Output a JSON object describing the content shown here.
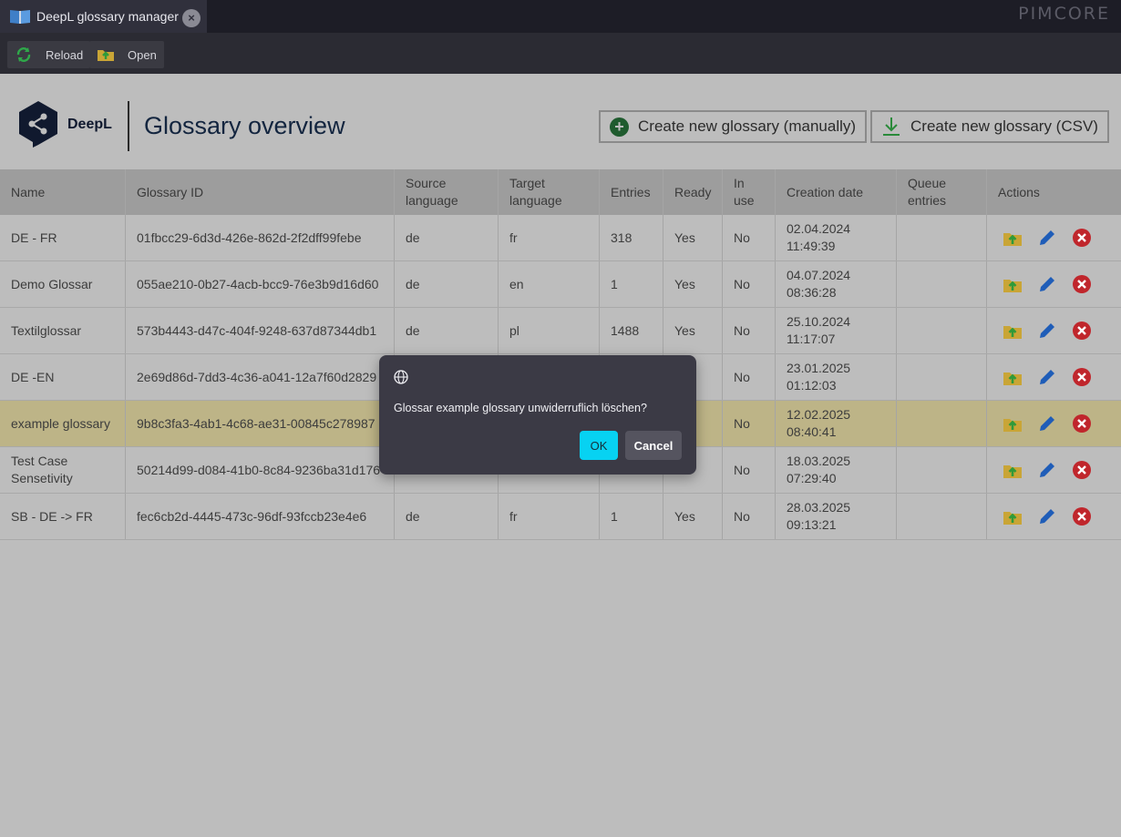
{
  "tab": {
    "title": "DeepL glossary manager",
    "close_symbol": "×"
  },
  "brand": "PIMCORE",
  "toolbar": {
    "reload_label": "Reload",
    "open_label": "Open"
  },
  "header": {
    "logo_text": "DeepL",
    "page_title": "Glossary overview",
    "create_manual_label": "Create new glossary (manually)",
    "create_csv_label": "Create new glossary (CSV)",
    "plus_symbol": "+"
  },
  "table": {
    "columns": [
      "Name",
      "Glossary ID",
      "Source language",
      "Target language",
      "Entries",
      "Ready",
      "In use",
      "Creation date",
      "Queue entries",
      "Actions"
    ],
    "rows": [
      {
        "name": "DE - FR",
        "id": "01fbcc29-6d3d-426e-862d-2f2dff99febe",
        "source": "de",
        "target": "fr",
        "entries": "318",
        "ready": "Yes",
        "in_use": "No",
        "date": "02.04.2024 11:49:39",
        "queue": ""
      },
      {
        "name": "Demo Glossar",
        "id": "055ae210-0b27-4acb-bcc9-76e3b9d16d60",
        "source": "de",
        "target": "en",
        "entries": "1",
        "ready": "Yes",
        "in_use": "No",
        "date": "04.07.2024 08:36:28",
        "queue": ""
      },
      {
        "name": "Textilglossar",
        "id": "573b4443-d47c-404f-9248-637d87344db1",
        "source": "de",
        "target": "pl",
        "entries": "1488",
        "ready": "Yes",
        "in_use": "No",
        "date": "25.10.2024 11:17:07",
        "queue": ""
      },
      {
        "name": "DE -EN",
        "id": "2e69d86d-7dd3-4c36-a041-12a7f60d2829",
        "source": "",
        "target": "",
        "entries": "",
        "ready": "",
        "in_use": "No",
        "date": "23.01.2025 01:12:03",
        "queue": ""
      },
      {
        "name": "example glossary",
        "id": "9b8c3fa3-4ab1-4c68-ae31-00845c278987",
        "source": "",
        "target": "",
        "entries": "",
        "ready": "",
        "in_use": "No",
        "date": "12.02.2025 08:40:41",
        "queue": "",
        "selected": true
      },
      {
        "name": "Test Case Sensetivity",
        "id": "50214d99-d084-41b0-8c84-9236ba31d176",
        "source": "",
        "target": "",
        "entries": "",
        "ready": "",
        "in_use": "No",
        "date": "18.03.2025 07:29:40",
        "queue": ""
      },
      {
        "name": "SB - DE -> FR",
        "id": "fec6cb2d-4445-473c-96df-93fccb23e4e6",
        "source": "de",
        "target": "fr",
        "entries": "1",
        "ready": "Yes",
        "in_use": "No",
        "date": "28.03.2025 09:13:21",
        "queue": ""
      }
    ]
  },
  "dialog": {
    "message": "Glossar example glossary unwiderruflich löschen?",
    "ok_label": "OK",
    "cancel_label": "Cancel"
  },
  "colors": {
    "accent": "#07d2f2",
    "selected_row": "#bdb487",
    "delete": "#c0262c",
    "edit": "#1f5db8"
  }
}
